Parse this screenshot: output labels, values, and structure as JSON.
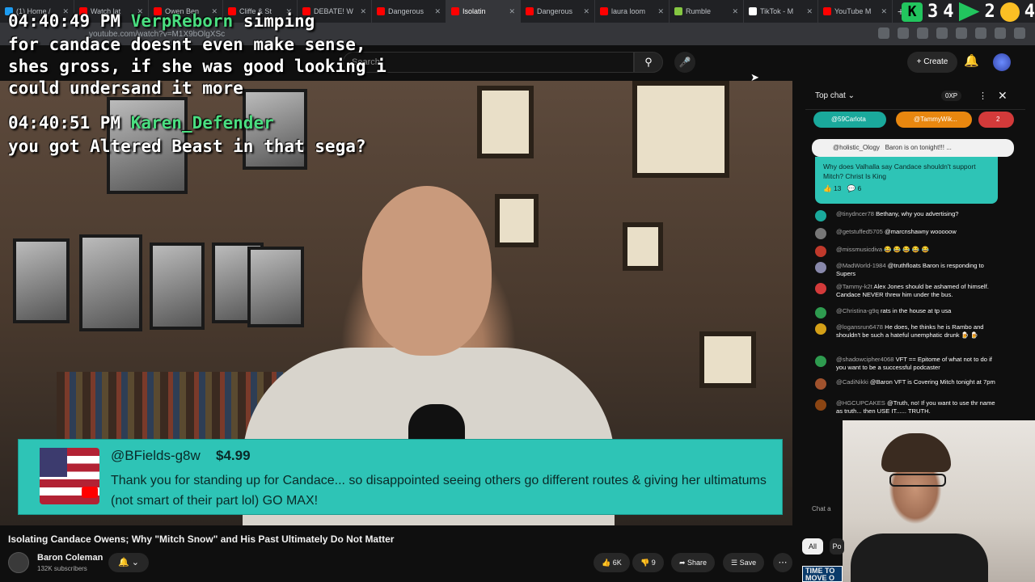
{
  "browser": {
    "tabs": [
      {
        "label": "(1) Home /",
        "color": "#1d9bf0"
      },
      {
        "label": "Watch lat",
        "color": "#ff0000"
      },
      {
        "label": "Owen Ben",
        "color": "#ff0000"
      },
      {
        "label": "Cliffe & St",
        "color": "#ff0000"
      },
      {
        "label": "DEBATE! W",
        "color": "#ff0000"
      },
      {
        "label": "Dangerous",
        "color": "#ff0000"
      },
      {
        "label": "Isolatin",
        "color": "#ff0000",
        "active": true
      },
      {
        "label": "Dangerous",
        "color": "#ff0000"
      },
      {
        "label": "laura loom",
        "color": "#ff0000"
      },
      {
        "label": "Rumble",
        "color": "#85c742"
      },
      {
        "label": "TikTok - M",
        "color": "#ffffff"
      },
      {
        "label": "YouTube M",
        "color": "#ff0000"
      }
    ],
    "new_tab": "+",
    "url": "youtube.com/watch?v=M1X9bOlgXSc"
  },
  "overlay": {
    "top_right_numbers": [
      "3",
      "4",
      "2",
      "4"
    ],
    "kick_letter": "K",
    "line1_time": "04:40:49 PM",
    "line1_user": "VerpReborn",
    "line1_text": "simping",
    "line2": "for candace doesnt even make sense,",
    "line3": "shes gross, if she was good looking i",
    "line4": "could undersand it more",
    "line5_time": "04:40:51 PM",
    "line5_user": "Karen_Defender",
    "line6": "you got Altered Beast in that sega?"
  },
  "youtube": {
    "search_placeholder": "Search",
    "create_label": "Create",
    "icons": {
      "search": "search-icon",
      "mic": "mic-icon",
      "bell": "bell-icon"
    }
  },
  "superchat": {
    "name": "@BFields-g8w",
    "amount": "$4.99",
    "message": "Thank you for standing up for Candace... so disappointed seeing others go different routes & giving her ultimatums (not smart of their part lol) GO MAX!",
    "bg_color": "#2ec4b6"
  },
  "video": {
    "title": "Isolating Candace Owens; Why \"Mitch Snow\" and His Past Ultimately Do Not Matter",
    "channel": "Baron Coleman",
    "subscribers": "132K subscribers",
    "likes": "6K",
    "dislikes": "9",
    "share_label": "Share",
    "save_label": "Save"
  },
  "chat": {
    "title": "Top chat",
    "xp": "0XP",
    "tickers": [
      {
        "label": "@59Carlota",
        "color": "#1aa99c"
      },
      {
        "label": "@TammyWik...",
        "color": "#e8870f"
      },
      {
        "label": "2",
        "color": "#d33a3a"
      }
    ],
    "pinned": {
      "user": "@holistic_Ology",
      "header_text": "Baron is on tonight!!! ...",
      "message": "Why does Valhalla say Candace shouldn't support Mitch? Christ Is King",
      "likes": "13",
      "replies": "6"
    },
    "messages": [
      {
        "user": "@tinydncer78",
        "text": "Bethany, why you advertising?",
        "color": "#1aa99c"
      },
      {
        "user": "@getstuffed5705",
        "text": "@marcnshawny  wooooow",
        "color": "#777777"
      },
      {
        "user": "@missmusicdiva",
        "text": "😂 😂 😂 😂 😂",
        "color": "#c0392b"
      },
      {
        "user": "@MadWorld-1984",
        "text": "@truthfloats Baron is responding to Supers",
        "color": "#8888aa"
      },
      {
        "user": "@Tammy-k2t",
        "text": "Alex Jones should be ashamed of himself. Candace NEVER threw him under the bus.",
        "color": "#d33a3a"
      },
      {
        "user": "@Christina-g9q",
        "text": "rats in the house at tp usa",
        "color": "#2e9b4f"
      },
      {
        "user": "@logansrun6478",
        "text": "He does, he thinks he is Rambo and shouldn't be such a hateful unemphatic drunk 🍺 🍺",
        "color": "#d4a017"
      },
      {
        "user": "@shadowcipher4068",
        "text": "VFT == Epitome of what not to do if you want to be a successful podcaster",
        "color": "#2e9b4f"
      },
      {
        "user": "@CadiNikki",
        "text": "@Baron VFT is Covering Mitch tonight at 7pm",
        "color": "#a0522d"
      },
      {
        "user": "@HGCUPCAKES",
        "text": "@Truth, no! If you want to use thr name as truth... then USE IT...... TRUTH.",
        "color": "#8b4513"
      }
    ],
    "input_placeholder": "Chat a",
    "filter_all": "All",
    "filter_next": "Po",
    "promo_text": "TIME TO MOVE O"
  }
}
